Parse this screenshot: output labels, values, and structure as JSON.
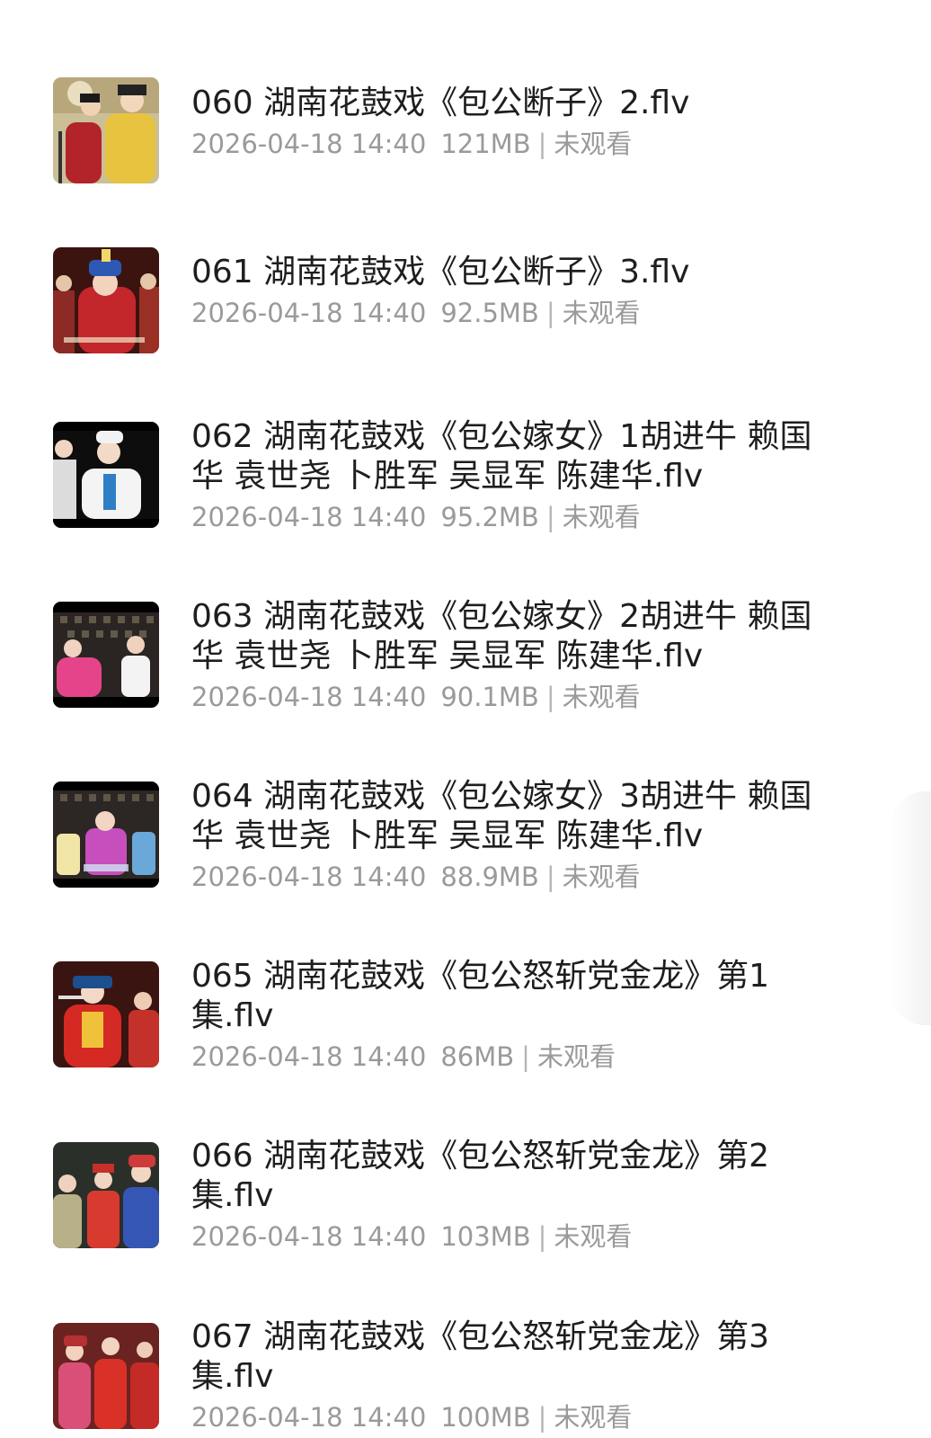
{
  "files": [
    {
      "title": "060 湖南花鼓戏《包公断子》2.flv",
      "date": "2026-04-18 14:40",
      "size": "121MB",
      "status": "未观看",
      "thumbnail_icon": "video-thumbnail"
    },
    {
      "title": "061 湖南花鼓戏《包公断子》3.flv",
      "date": "2026-04-18 14:40",
      "size": "92.5MB",
      "status": "未观看",
      "thumbnail_icon": "video-thumbnail"
    },
    {
      "title": "062 湖南花鼓戏《包公嫁女》1胡进牛 赖国华 袁世尧 卜胜军 吴显军 陈建华.flv",
      "date": "2026-04-18 14:40",
      "size": "95.2MB",
      "status": "未观看",
      "thumbnail_icon": "video-thumbnail"
    },
    {
      "title": "063 湖南花鼓戏《包公嫁女》2胡进牛 赖国华 袁世尧 卜胜军 吴显军 陈建华.flv",
      "date": "2026-04-18 14:40",
      "size": "90.1MB",
      "status": "未观看",
      "thumbnail_icon": "video-thumbnail"
    },
    {
      "title": "064 湖南花鼓戏《包公嫁女》3胡进牛 赖国华 袁世尧 卜胜军 吴显军 陈建华.flv",
      "date": "2026-04-18 14:40",
      "size": "88.9MB",
      "status": "未观看",
      "thumbnail_icon": "video-thumbnail"
    },
    {
      "title": "065 湖南花鼓戏《包公怒斩党金龙》第1集.flv",
      "date": "2026-04-18 14:40",
      "size": "86MB",
      "status": "未观看",
      "thumbnail_icon": "video-thumbnail"
    },
    {
      "title": "066 湖南花鼓戏《包公怒斩党金龙》第2集.flv",
      "date": "2026-04-18 14:40",
      "size": "103MB",
      "status": "未观看",
      "thumbnail_icon": "video-thumbnail"
    },
    {
      "title": "067 湖南花鼓戏《包公怒斩党金龙》第3集.flv",
      "date": "2026-04-18 14:40",
      "size": "100MB",
      "status": "未观看",
      "thumbnail_icon": "video-thumbnail"
    }
  ],
  "colors": {
    "title": "#1e1e1e",
    "meta": "#9a9a9a",
    "background": "#ffffff"
  }
}
